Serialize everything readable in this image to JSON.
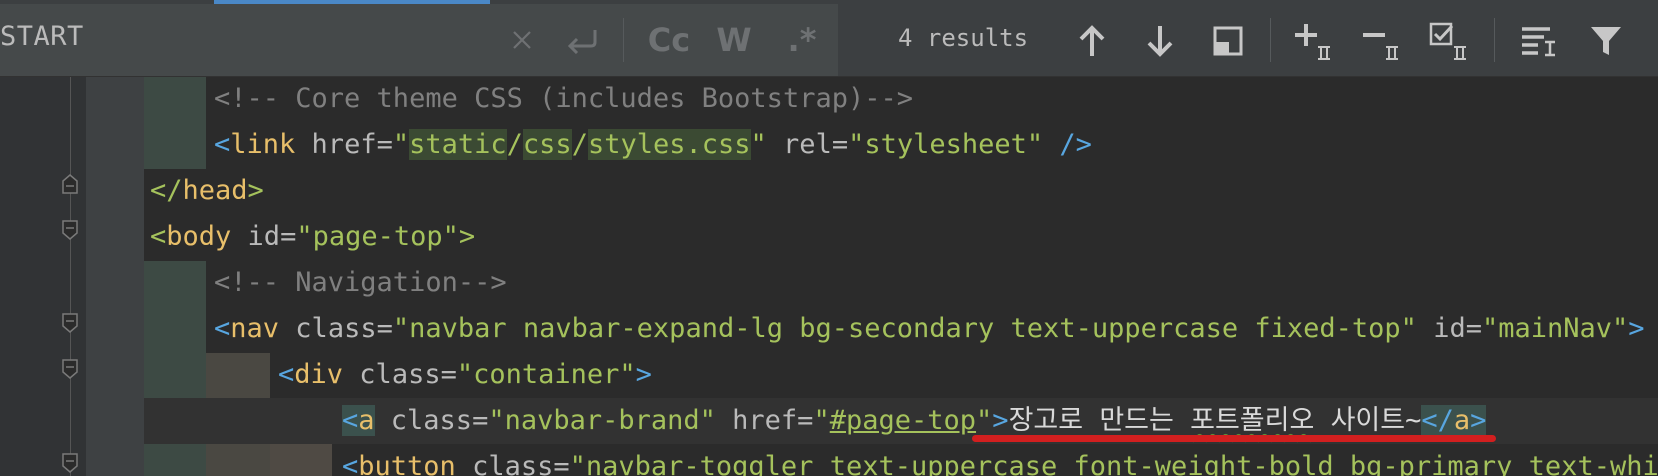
{
  "search": {
    "query": "START",
    "results": "4 results"
  },
  "find_toolbar": {
    "clear": "×",
    "match_case": "Cc",
    "words": "W",
    "regex": ".*"
  },
  "colors": {
    "accent": "#4a88c7",
    "annotation": "#d21f1f"
  },
  "icons": [
    "close-icon",
    "newline-icon",
    "arrow-up-icon",
    "arrow-down-icon",
    "open-in-window-icon",
    "add-selection-icon",
    "remove-selection-icon",
    "select-all-occurrences-icon",
    "filter-settings-icon",
    "filter-icon"
  ],
  "code": {
    "l1": "<!-- Core theme CSS (includes Bootstrap)-->",
    "l2_open": "<",
    "l2_tag": "link",
    "l2_attr1": " href=",
    "l2_q": "\"",
    "l2_v1": "static",
    "l2_slash1": "/",
    "l2_v2": "css",
    "l2_slash2": "/",
    "l2_v3": "styles.css",
    "l2_q2": "\"",
    "l2_attr2": " rel=",
    "l2_v4": "\"stylesheet\"",
    "l2_end": " />",
    "l3_open": "</",
    "l3_tag": "head",
    "l3_close": ">",
    "l4_open": "<",
    "l4_tag": "body",
    "l4_attr": " id=",
    "l4_val": "\"page-top\"",
    "l4_close": ">",
    "l5": "<!-- Navigation-->",
    "l6_open": "<",
    "l6_tag": "nav",
    "l6_attr": " class=",
    "l6_val": "\"navbar navbar-expand-lg bg-secondary text-uppercase fixed-top\"",
    "l6_attr2": " id=",
    "l6_val2": "\"mainNav\"",
    "l6_close": ">",
    "l7_open": "<",
    "l7_tag": "div",
    "l7_attr": " class=",
    "l7_val": "\"container\"",
    "l7_close": ">",
    "l8_open": "<",
    "l8_tag": "a",
    "l8_attr": " class=",
    "l8_val": "\"navbar-brand\"",
    "l8_attr2": " href=",
    "l8_q": "\"",
    "l8_val2": "#page-top",
    "l8_q2": "\"",
    "l8_gt": ">",
    "l8_text1": "장고로 만드는 ",
    "l8_text2": "포트폴리오",
    "l8_text3": " 사이트~",
    "l8_endtag_open": "</",
    "l8_endtag": "a",
    "l8_endtag_close": ">",
    "l9_open": "<",
    "l9_tag": "button",
    "l9_attr": " class=",
    "l9_val": "\"navbar-toggler text-uppercase font-weight-bold bg-primary text-white"
  }
}
